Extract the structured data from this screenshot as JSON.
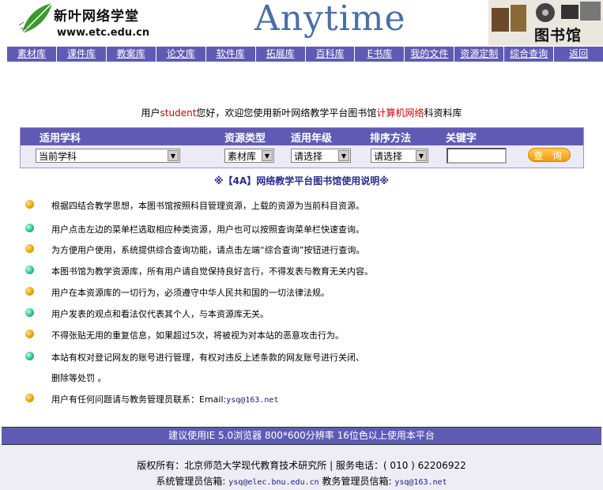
{
  "header": {
    "site_name": "新叶网络学堂",
    "site_url": "www.etc.edu.cn",
    "banner_title": "Anytime",
    "library_label": "图书馆"
  },
  "nav": {
    "items": [
      "素材库",
      "课件库",
      "教案库",
      "论文库",
      "软件库",
      "拓展库",
      "百科库",
      "E书库",
      "我的文件",
      "资源定制",
      "综合查询",
      "返回"
    ]
  },
  "welcome": {
    "prefix": "用户",
    "username": "student",
    "middle": "您好，欢迎您使用新叶网络教学平台图书馆",
    "subject": "计算机网络",
    "suffix": "科资料库"
  },
  "search": {
    "headers": [
      "适用学科",
      "资源类型",
      "适用年级",
      "排序方法",
      "关键字"
    ],
    "subject_value": "当前学科",
    "type_value": "素材库",
    "grade_value": "请选择",
    "sort_value": "请选择",
    "keyword_value": "",
    "query_label": "查 询"
  },
  "guide": {
    "title": "※【4A】网络教学平台图书馆使用说明※",
    "rules": [
      {
        "text": "根据四结合教学思想，本图书馆按照科目管理资源，上载的资源为当前科目资源。",
        "bullet": "orange"
      },
      {
        "text": "用户点击左边的菜单栏选取相应种类资源，用户也可以按照查询菜单栏快速查询。",
        "bullet": "green"
      },
      {
        "text": "为方便用户使用，系统提供综合查询功能，请点击左端“综合查询”按钮进行查询。",
        "bullet": "orange"
      },
      {
        "text": "本图书馆为教学资源库，所有用户请自觉保持良好言行，不得发表与教育无关内容。",
        "bullet": "green"
      },
      {
        "text": "用户在本资源库的一切行为，必须遵守中华人民共和国的一切法律法规。",
        "bullet": "orange"
      },
      {
        "text": "用户发表的观点和看法仅代表其个人，与本资源库无关。",
        "bullet": "green"
      },
      {
        "text": "不得张贴无用的重复信息，如果超过5次，将被视为对本站的恶意攻击行为。",
        "bullet": "orange"
      },
      {
        "text": "本站有权对登记网友的账号进行管理，有权对违反上述条款的网友账号进行关闭、",
        "bullet": "green"
      },
      {
        "text": "删除等处罚 。",
        "bullet": "none"
      },
      {
        "text": "用户有任何问题请与教务管理员联系：Email:",
        "bullet": "orange",
        "email": "ysq@163.net"
      }
    ]
  },
  "footer": {
    "recommend": "建议使用IE 5.0浏览器 800*600分辨率 16位色以上使用本平台",
    "copyright": "版权所有：北京师范大学现代教育技术研究所 | 服务电话：( 010 ) 62206922",
    "sysadmin_label": "系统管理员信箱:",
    "sysadmin_email": "ysq@elec.bnu.edu.cn",
    "eduadmin_label": "教务管理员信箱:",
    "eduadmin_email": "ysq@163.net"
  },
  "colors": {
    "nav_bg": "#5f5bb5",
    "accent_red": "#cc0000",
    "title_blue": "#4a6fa5"
  }
}
